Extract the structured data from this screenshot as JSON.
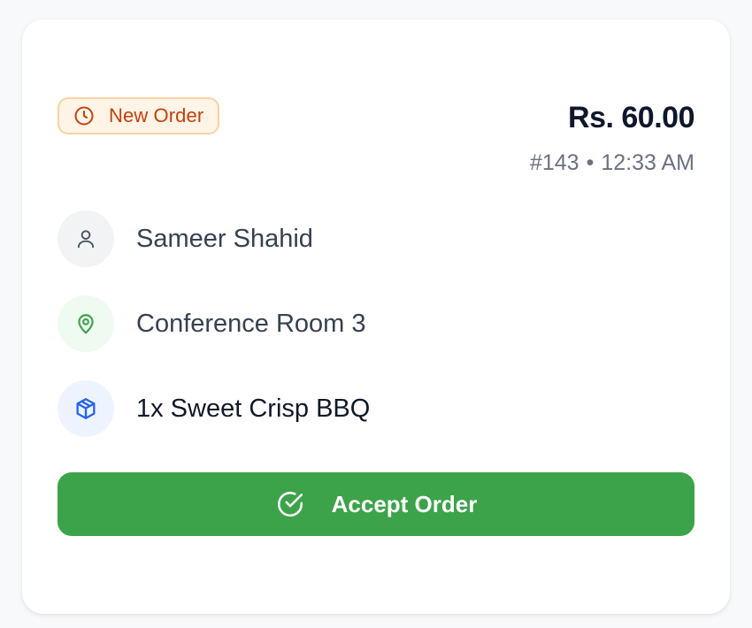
{
  "order": {
    "status_label": "New Order",
    "price": "Rs. 60.00",
    "number": "#143",
    "separator": "•",
    "time": "12:33 AM",
    "customer": "Sameer Shahid",
    "location": "Conference Room 3",
    "items": "1x Sweet Crisp BBQ"
  },
  "actions": {
    "accept_label": "Accept Order"
  },
  "icons": {
    "status": "clock-icon",
    "customer": "user-icon",
    "location": "map-pin-icon",
    "items": "package-icon",
    "accept": "check-circle-icon"
  },
  "colors": {
    "badge_text": "#c2410c",
    "badge_bg": "#fff4e6",
    "accept_bg": "#3da34a",
    "location_icon": "#3da34a",
    "package_icon": "#2563eb"
  }
}
